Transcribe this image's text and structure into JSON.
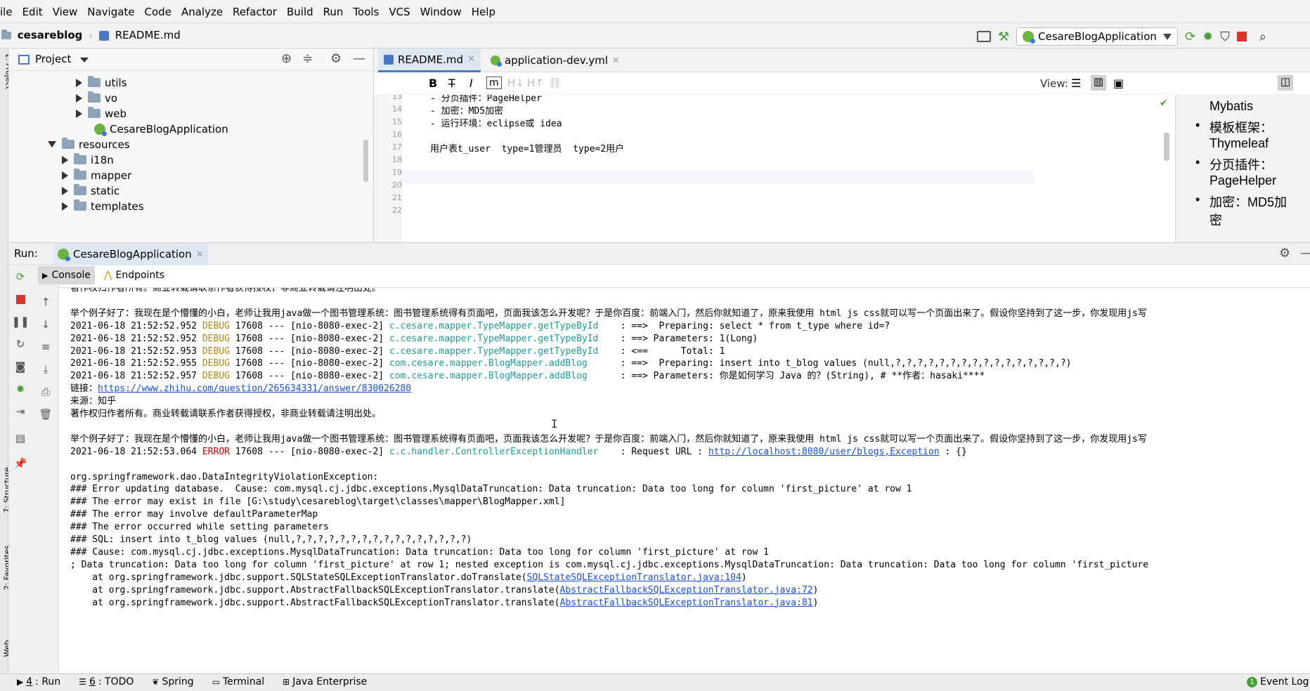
{
  "menu": [
    "ile",
    "Edit",
    "View",
    "Navigate",
    "Code",
    "Analyze",
    "Refactor",
    "Build",
    "Run",
    "Tools",
    "VCS",
    "Window",
    "Help"
  ],
  "breadcrumb": {
    "project": "cesareblog",
    "file": "README.md"
  },
  "run_config": "CesareBlogApplication",
  "project_panel": {
    "title": "Project",
    "items": [
      {
        "label": "utils",
        "type": "folder",
        "expanded": false
      },
      {
        "label": "vo",
        "type": "folder",
        "expanded": false
      },
      {
        "label": "web",
        "type": "folder",
        "expanded": false
      },
      {
        "label": "CesareBlogApplication",
        "type": "class"
      },
      {
        "label": "resources",
        "type": "folder",
        "expanded": true
      },
      {
        "label": "i18n",
        "type": "folder",
        "expanded": false
      },
      {
        "label": "mapper",
        "type": "folder",
        "expanded": false
      },
      {
        "label": "static",
        "type": "folder",
        "expanded": false
      },
      {
        "label": "templates",
        "type": "folder",
        "expanded": false
      }
    ]
  },
  "editor": {
    "tabs": [
      {
        "label": "README.md",
        "active": true
      },
      {
        "label": "application-dev.yml",
        "active": false
      }
    ],
    "format_buttons": [
      "B",
      "T̶",
      "I",
      "m"
    ],
    "view_label": "View:",
    "lines": [
      {
        "n": "13",
        "text": "- 分页插件：PageHelper"
      },
      {
        "n": "14",
        "text": "- 加密：MD5加密"
      },
      {
        "n": "15",
        "text": "- 运行环境：eclipse或 idea"
      },
      {
        "n": "16",
        "text": ""
      },
      {
        "n": "17",
        "text": "用户表t_user  type=1管理员  type=2用户"
      },
      {
        "n": "18",
        "text": ""
      },
      {
        "n": "19",
        "text": ""
      },
      {
        "n": "20",
        "text": ""
      },
      {
        "n": "21",
        "text": ""
      },
      {
        "n": "22",
        "text": ""
      }
    ]
  },
  "preview": {
    "items": [
      {
        "bullet": false,
        "text": "Mybatis"
      },
      {
        "bullet": true,
        "text": "模板框架："
      },
      {
        "bullet": false,
        "text": "Thymeleaf"
      },
      {
        "bullet": true,
        "text": "分页插件："
      },
      {
        "bullet": false,
        "text": "PageHelper"
      },
      {
        "bullet": true,
        "text": "加密：MD5加"
      },
      {
        "bullet": false,
        "text": "密"
      }
    ]
  },
  "run_panel": {
    "label": "Run:",
    "tab": "CesareBlogApplication",
    "subtabs": [
      "Console",
      "Endpoints"
    ]
  },
  "console": [
    {
      "segs": [
        {
          "t": "著作权归作者所有。商业转载请联系作者获得授权，非商业转载请注明出处。"
        }
      ]
    },
    {
      "segs": [
        {
          "t": ""
        }
      ]
    },
    {
      "segs": [
        {
          "t": "举个例子好了：我现在是个懵懂的小白，老师让我用java做一个图书管理系统：图书管理系统得有页面吧，页面我该怎么开发呢？于是你百度：前端入门，然后你就知道了，原来我使用 html js css就可以写一个页面出来了。假设你坚持到了这一步，你发现用js写"
        }
      ]
    },
    {
      "segs": [
        {
          "t": "2021-06-18 21:52:52.952 "
        },
        {
          "t": "DEBUG",
          "c": "dbg"
        },
        {
          "t": " 17608 --- [nio-8080-exec-2] "
        },
        {
          "t": "c.cesare.mapper.TypeMapper.getTypeById   ",
          "c": "cls"
        },
        {
          "t": " : ==>  Preparing: select * from t_type where id=?"
        }
      ]
    },
    {
      "segs": [
        {
          "t": "2021-06-18 21:52:52.952 "
        },
        {
          "t": "DEBUG",
          "c": "dbg"
        },
        {
          "t": " 17608 --- [nio-8080-exec-2] "
        },
        {
          "t": "c.cesare.mapper.TypeMapper.getTypeById   ",
          "c": "cls"
        },
        {
          "t": " : ==> Parameters: 1(Long)"
        }
      ]
    },
    {
      "segs": [
        {
          "t": "2021-06-18 21:52:52.953 "
        },
        {
          "t": "DEBUG",
          "c": "dbg"
        },
        {
          "t": " 17608 --- [nio-8080-exec-2] "
        },
        {
          "t": "c.cesare.mapper.TypeMapper.getTypeById   ",
          "c": "cls"
        },
        {
          "t": " : <==      Total: 1"
        }
      ]
    },
    {
      "segs": [
        {
          "t": "2021-06-18 21:52:52.955 "
        },
        {
          "t": "DEBUG",
          "c": "dbg"
        },
        {
          "t": " 17608 --- [nio-8080-exec-2] "
        },
        {
          "t": "com.cesare.mapper.BlogMapper.addBlog     ",
          "c": "cls"
        },
        {
          "t": " : ==>  Preparing: insert into t_blog values (null,?,?,?,?,?,?,?,?,?,?,?,?,?,?,?,?)"
        }
      ]
    },
    {
      "segs": [
        {
          "t": "2021-06-18 21:52:52.957 "
        },
        {
          "t": "DEBUG",
          "c": "dbg"
        },
        {
          "t": " 17608 --- [nio-8080-exec-2] "
        },
        {
          "t": "com.cesare.mapper.BlogMapper.addBlog     ",
          "c": "cls"
        },
        {
          "t": " : ==> Parameters: 你是如何学习 Java 的？(String), # **作者：hasaki****"
        }
      ]
    },
    {
      "segs": [
        {
          "t": "链接："
        },
        {
          "t": "https://www.zhihu.com/question/265634331/answer/830026280",
          "c": "lnk"
        }
      ]
    },
    {
      "segs": [
        {
          "t": "来源：知乎"
        }
      ]
    },
    {
      "segs": [
        {
          "t": "著作权归作者所有。商业转载请联系作者获得授权，非商业转载请注明出处。"
        }
      ]
    },
    {
      "segs": [
        {
          "t": ""
        }
      ]
    },
    {
      "segs": [
        {
          "t": "举个例子好了：我现在是个懵懂的小白，老师让我用java做一个图书管理系统：图书管理系统得有页面吧，页面我该怎么开发呢？于是你百度：前端入门，然后你就知道了，原来我使用 html js css就可以写一个页面出来了。假设你坚持到了这一步，你发现用js写"
        }
      ]
    },
    {
      "segs": [
        {
          "t": "2021-06-18 21:52:53.064 "
        },
        {
          "t": "ERROR",
          "c": "err"
        },
        {
          "t": " 17608 --- [nio-8080-exec-2] "
        },
        {
          "t": "c.c.handler.ControllerExceptionHandler   ",
          "c": "cls"
        },
        {
          "t": " : Request URL : "
        },
        {
          "t": "http://localhost:8080/user/blogs,Exception",
          "c": "lnk"
        },
        {
          "t": " : {}"
        }
      ]
    },
    {
      "segs": [
        {
          "t": ""
        }
      ]
    },
    {
      "segs": [
        {
          "t": "org.springframework.dao.DataIntegrityViolationException:"
        }
      ]
    },
    {
      "segs": [
        {
          "t": "### Error updating database.  Cause: com.mysql.cj.jdbc.exceptions.MysqlDataTruncation: Data truncation: Data too long for column 'first_picture' at row 1"
        }
      ]
    },
    {
      "segs": [
        {
          "t": "### The error may exist in file [G:\\study\\cesareblog\\target\\classes\\mapper\\BlogMapper.xml]"
        }
      ]
    },
    {
      "segs": [
        {
          "t": "### The error may involve defaultParameterMap"
        }
      ]
    },
    {
      "segs": [
        {
          "t": "### The error occurred while setting parameters"
        }
      ]
    },
    {
      "segs": [
        {
          "t": "### SQL: insert into t_blog values (null,?,?,?,?,?,?,?,?,?,?,?,?,?,?,?,?)"
        }
      ]
    },
    {
      "segs": [
        {
          "t": "### Cause: com.mysql.cj.jdbc.exceptions.MysqlDataTruncation: Data truncation: Data too long for column 'first_picture' at row 1"
        }
      ]
    },
    {
      "segs": [
        {
          "t": "; Data truncation: Data too long for column 'first_picture' at row 1; nested exception is com.mysql.cj.jdbc.exceptions.MysqlDataTruncation: Data truncation: Data too long for column 'first_picture"
        }
      ]
    },
    {
      "segs": [
        {
          "t": "    at org.springframework.jdbc.support.SQLStateSQLExceptionTranslator.doTranslate("
        },
        {
          "t": "SQLStateSQLExceptionTranslator.java:104",
          "c": "lnk"
        },
        {
          "t": ")"
        }
      ]
    },
    {
      "segs": [
        {
          "t": "    at org.springframework.jdbc.support.AbstractFallbackSQLExceptionTranslator.translate("
        },
        {
          "t": "AbstractFallbackSQLExceptionTranslator.java:72",
          "c": "lnk"
        },
        {
          "t": ")"
        }
      ]
    },
    {
      "segs": [
        {
          "t": "    at org.springframework.jdbc.support.AbstractFallbackSQLExceptionTranslator.translate("
        },
        {
          "t": "AbstractFallbackSQLExceptionTranslator.java:81",
          "c": "lnk"
        },
        {
          "t": ")"
        }
      ]
    }
  ],
  "bottom_bar": {
    "tabs": [
      {
        "num": "4",
        "label": ": Run"
      },
      {
        "num": "6",
        "label": ": TODO"
      },
      {
        "num": "",
        "label": "Spring"
      },
      {
        "num": "",
        "label": "Terminal"
      },
      {
        "num": "",
        "label": "Java Enterprise"
      }
    ],
    "event_log": "Event Log",
    "event_count": "1"
  },
  "side_labels": {
    "project": "1: Project",
    "structure": "7: Structure",
    "favorites": "2: Favorites",
    "web": "Web"
  }
}
